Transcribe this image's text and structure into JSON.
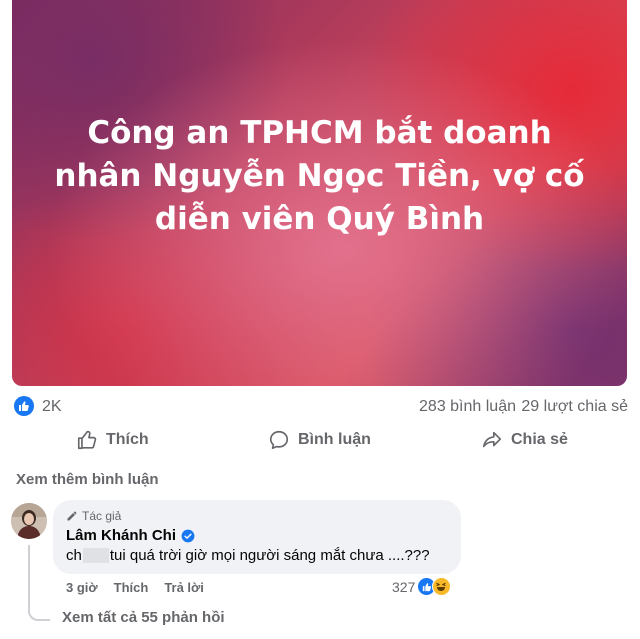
{
  "post": {
    "banner_title": "Công an TPHCM bắt doanh nhân Nguyễn Ngọc Tiền, vợ cố diễn viên Quý Bình"
  },
  "stats": {
    "reactions": "2K",
    "comments": "283 bình luận",
    "shares": "29 lượt chia sẻ"
  },
  "actions": {
    "like": "Thích",
    "comment": "Bình luận",
    "share": "Chia sẻ"
  },
  "comments_section": {
    "view_more": "Xem thêm bình luận",
    "comment": {
      "badge": "Tác giả",
      "author": "Lâm Khánh Chi",
      "text_before": "ch",
      "text_after": "tui quá trời giờ mọi người sáng mắt chưa ....???",
      "time": "3 giờ",
      "like_label": "Thích",
      "reply_label": "Trả lời",
      "reaction_count": "327"
    },
    "view_replies": "Xem tất cả 55 phản hồi"
  },
  "colors": {
    "accent": "#1877f2",
    "muted_text": "#65676b",
    "bubble_bg": "#f0f2f5"
  },
  "icons": [
    "like-icon",
    "comment-icon",
    "share-icon",
    "pencil-icon",
    "verified-icon",
    "haha-icon"
  ]
}
